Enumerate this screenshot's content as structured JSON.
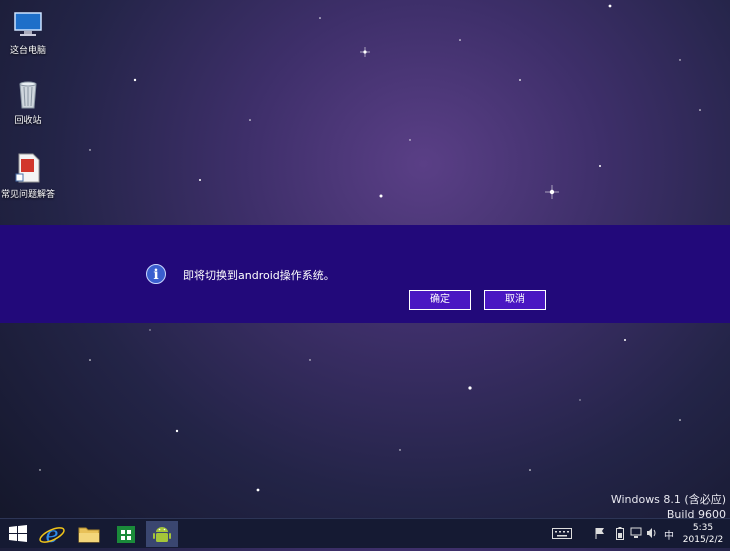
{
  "desktop": {
    "icons": [
      {
        "label": "这台电脑",
        "icon": "this-pc-icon"
      },
      {
        "label": "回收站",
        "icon": "recycle-bin-icon"
      },
      {
        "label": "常见问题解答",
        "icon": "faq-document-icon"
      }
    ]
  },
  "dialog": {
    "icon": "info-icon",
    "message": "即将切换到android操作系统。",
    "ok_label": "确定",
    "cancel_label": "取消",
    "background": "#22097a"
  },
  "watermark": {
    "line1": "Windows 8.1 (含必应)",
    "line2": "Build 9600"
  },
  "taskbar": {
    "apps": [
      "windows-start-icon",
      "internet-explorer-icon",
      "file-explorer-icon",
      "store-icon",
      "android-icon"
    ],
    "tray": {
      "keyboard_icon": "keyboard-icon",
      "flag_icon": "action-center-flag-icon",
      "battery_icon": "battery-icon",
      "network_icon": "network-icon",
      "volume_icon": "volume-icon",
      "ime_label": "中"
    },
    "clock": {
      "time": "5:35",
      "date": "2015/2/2"
    }
  }
}
